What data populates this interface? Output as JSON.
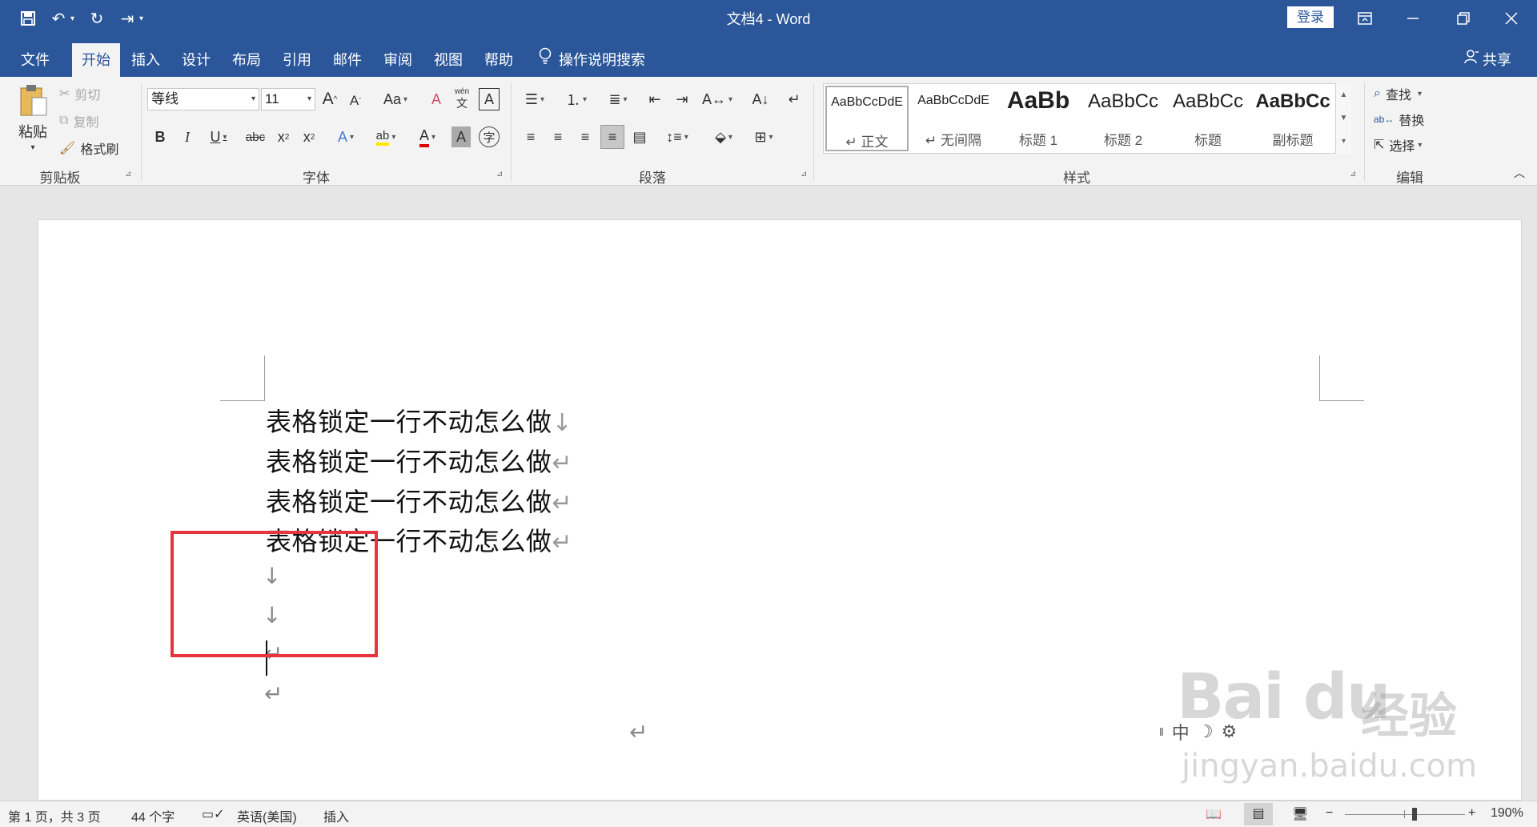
{
  "window": {
    "title": "文档4  -  Word",
    "login_label": "登录",
    "share_label": "共享",
    "tell_me": "操作说明搜索"
  },
  "tabs": [
    "文件",
    "开始",
    "插入",
    "设计",
    "布局",
    "引用",
    "邮件",
    "审阅",
    "视图",
    "帮助"
  ],
  "active_tab": "开始",
  "ribbon": {
    "clipboard": {
      "label": "剪贴板",
      "paste": "粘贴",
      "cut": "剪切",
      "copy": "复制",
      "format_painter": "格式刷"
    },
    "font": {
      "label": "字体",
      "font_name": "等线",
      "font_size": "11"
    },
    "paragraph": {
      "label": "段落"
    },
    "styles": {
      "label": "样式",
      "items": [
        {
          "sample": "AaBbCcDdE",
          "name": "↵ 正文"
        },
        {
          "sample": "AaBbCcDdE",
          "name": "↵ 无间隔"
        },
        {
          "sample": "AaBb",
          "name": "标题 1"
        },
        {
          "sample": "AaBbCc",
          "name": "标题 2"
        },
        {
          "sample": "AaBbCc",
          "name": "标题"
        },
        {
          "sample": "AaBbCc",
          "name": "副标题"
        }
      ]
    },
    "editing": {
      "label": "编辑",
      "find": "查找",
      "replace": "替换",
      "select": "选择"
    }
  },
  "document": {
    "lines": [
      {
        "text": "表格锁定一行不动怎么做",
        "mark": "↓"
      },
      {
        "text": "表格锁定一行不动怎么做",
        "mark": "↵"
      },
      {
        "text": "表格锁定一行不动怎么做",
        "mark": "↵"
      },
      {
        "text": "表格锁定一行不动怎么做",
        "mark": "↵"
      }
    ],
    "empty_marks": [
      "↓",
      "↓",
      "↵",
      "↵"
    ],
    "end_mark": "↵"
  },
  "ime": {
    "mode": "中"
  },
  "watermark": {
    "logo": "Bai du",
    "cn": "经验",
    "url": "jingyan.baidu.com"
  },
  "status": {
    "page": "第 1 页，共 3 页",
    "words": "44 个字",
    "language": "英语(美国)",
    "mode": "插入",
    "zoom": "190%"
  },
  "colors": {
    "brand": "#2b579a",
    "highlight_box": "#e8343f"
  }
}
